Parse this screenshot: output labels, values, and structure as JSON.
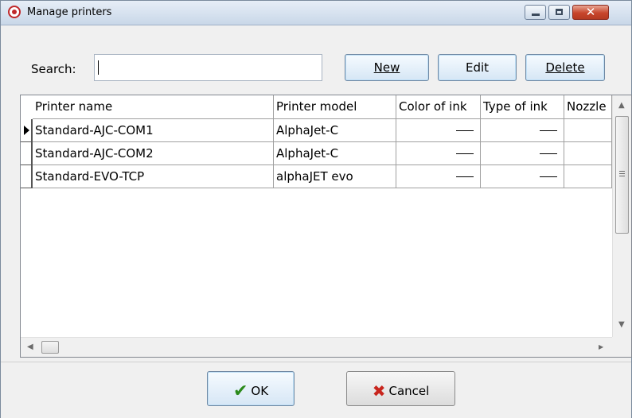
{
  "window": {
    "title": "Manage printers",
    "close_glyph": "✕"
  },
  "search": {
    "label": "Search:",
    "value": "",
    "placeholder": ""
  },
  "toolbar": {
    "new_label": "New",
    "edit_label": "Edit",
    "delete_label": "Delete"
  },
  "table": {
    "columns": [
      "Printer name",
      "Printer model",
      "Color of ink",
      "Type of ink",
      "Nozzle"
    ],
    "rows": [
      {
        "name": "Standard-AJC-COM1",
        "model": "AlphaJet-C",
        "selected": true
      },
      {
        "name": "Standard-AJC-COM2",
        "model": "AlphaJet-C",
        "selected": false
      },
      {
        "name": "Standard-EVO-TCP",
        "model": "alphaJET evo",
        "selected": false
      }
    ]
  },
  "footer": {
    "ok_label": "OK",
    "cancel_label": "Cancel"
  },
  "icons": {
    "app": "alphajet-app-icon",
    "ok": "checkmark-icon",
    "cancel": "x-mark-icon"
  },
  "colors": {
    "title_bar": "#c9d7e8",
    "close_button": "#c7452b",
    "ok_check": "#2b8a1b",
    "cancel_x": "#c8261e"
  }
}
